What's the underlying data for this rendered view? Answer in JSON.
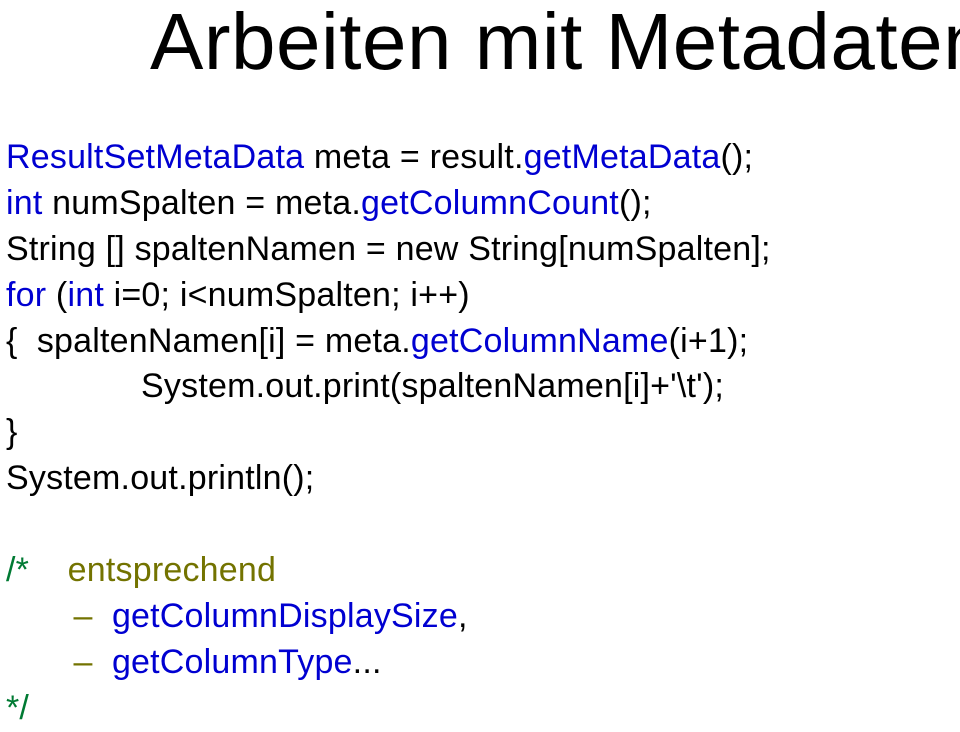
{
  "title": "Arbeiten mit Metadaten",
  "code": {
    "l1a": "ResultSetMetaData",
    "l1b": " meta = result.",
    "l1c": "getMetaData",
    "l1d": "();",
    "l2a": "int",
    "l2b": " numSpalten = meta.",
    "l2c": "getColumnCount",
    "l2d": "();",
    "l3": "String [] spaltenNamen = new String[numSpalten];",
    "l4a": "for",
    "l4b": " (",
    "l4c": "int",
    "l4d": " i=0; i<numSpalten; i++)",
    "l5a": "{  spaltenNamen[i] = meta.",
    "l5b": "getColumnName",
    "l5c": "(i+1);",
    "l6": "              System.out.print(spaltenNamen[i]+'\\t');",
    "l7": "}",
    "l8": "System.out.println();",
    "l9": "",
    "l10a": "/*",
    "l10b": "    entsprechend",
    "l11a": "       –  ",
    "l11b": "getColumnDisplaySize",
    "l11c": ",",
    "l12a": "       –  ",
    "l12b": "getColumnType",
    "l12c": "...",
    "l13": "*/"
  }
}
